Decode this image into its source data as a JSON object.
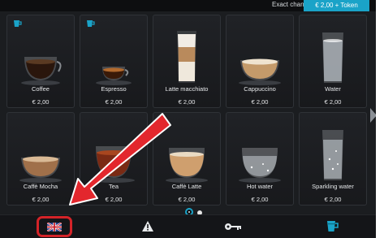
{
  "header": {
    "exact_change": "Exact change",
    "token_badge": "€ 2,00 + Token"
  },
  "products": [
    {
      "name": "Coffee",
      "price": "€ 2,00",
      "pot_icon": true
    },
    {
      "name": "Espresso",
      "price": "€ 2,00",
      "pot_icon": true
    },
    {
      "name": "Latte macchiato",
      "price": "€ 2,00",
      "pot_icon": false
    },
    {
      "name": "Cappuccino",
      "price": "€ 2,00",
      "pot_icon": false
    },
    {
      "name": "Water",
      "price": "€ 2,00",
      "pot_icon": false
    },
    {
      "name": "Caffè Mocha",
      "price": "€ 2,00",
      "pot_icon": false
    },
    {
      "name": "Tea",
      "price": "€ 2,00",
      "pot_icon": false
    },
    {
      "name": "Caffè Latte",
      "price": "€ 2,00",
      "pot_icon": false
    },
    {
      "name": "Hot water",
      "price": "€ 2,00",
      "pot_icon": false
    },
    {
      "name": "Sparkling water",
      "price": "€ 2,00",
      "pot_icon": false
    }
  ],
  "pagination": {
    "pages": 2,
    "current": 1
  },
  "bottom_bar": {
    "language_icon": "uk-flag-icon",
    "warning_icon": "warning-icon",
    "key_icon": "key-icon",
    "pot_icon": "coffee-pot-icon"
  },
  "colors": {
    "accent": "#1aa3c8",
    "highlight": "#d42328",
    "background": "#1b1d20"
  }
}
